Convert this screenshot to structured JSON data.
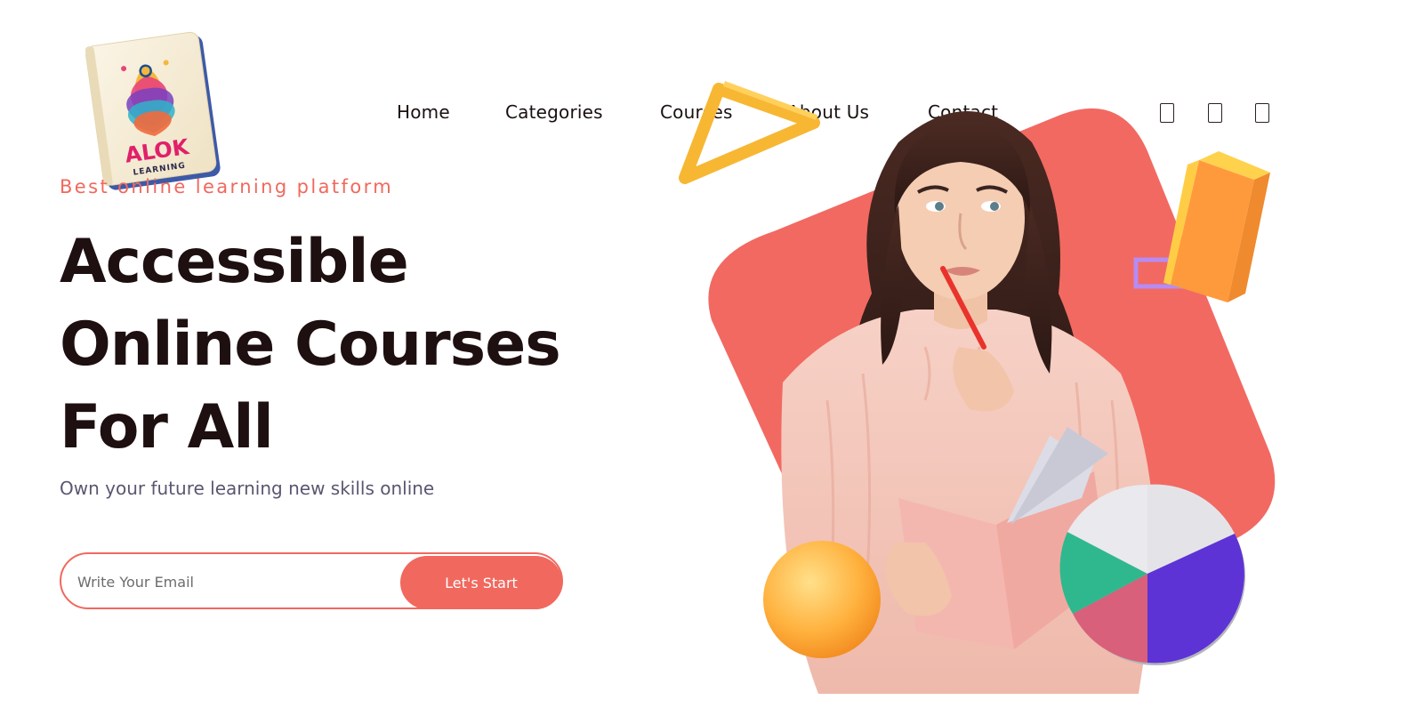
{
  "brand": {
    "logo_text": "ALOK",
    "logo_subtext": "LEARNING"
  },
  "nav": {
    "items": [
      {
        "label": "Home"
      },
      {
        "label": "Categories"
      },
      {
        "label": "Courses"
      },
      {
        "label": "About Us"
      },
      {
        "label": "Contact"
      }
    ],
    "icons": [
      "search-icon",
      "cart-icon",
      "user-icon"
    ]
  },
  "hero": {
    "tagline": "Best online learning platform",
    "headline": [
      "Accessible",
      "Online Courses",
      "For All"
    ],
    "subtext": "Own your future learning new skills online",
    "email_placeholder": "Write Your Email",
    "cta_label": "Let's Start"
  },
  "colors": {
    "accent": "#f1685e",
    "heading": "#1e0f10",
    "subtext": "#5b5670"
  }
}
